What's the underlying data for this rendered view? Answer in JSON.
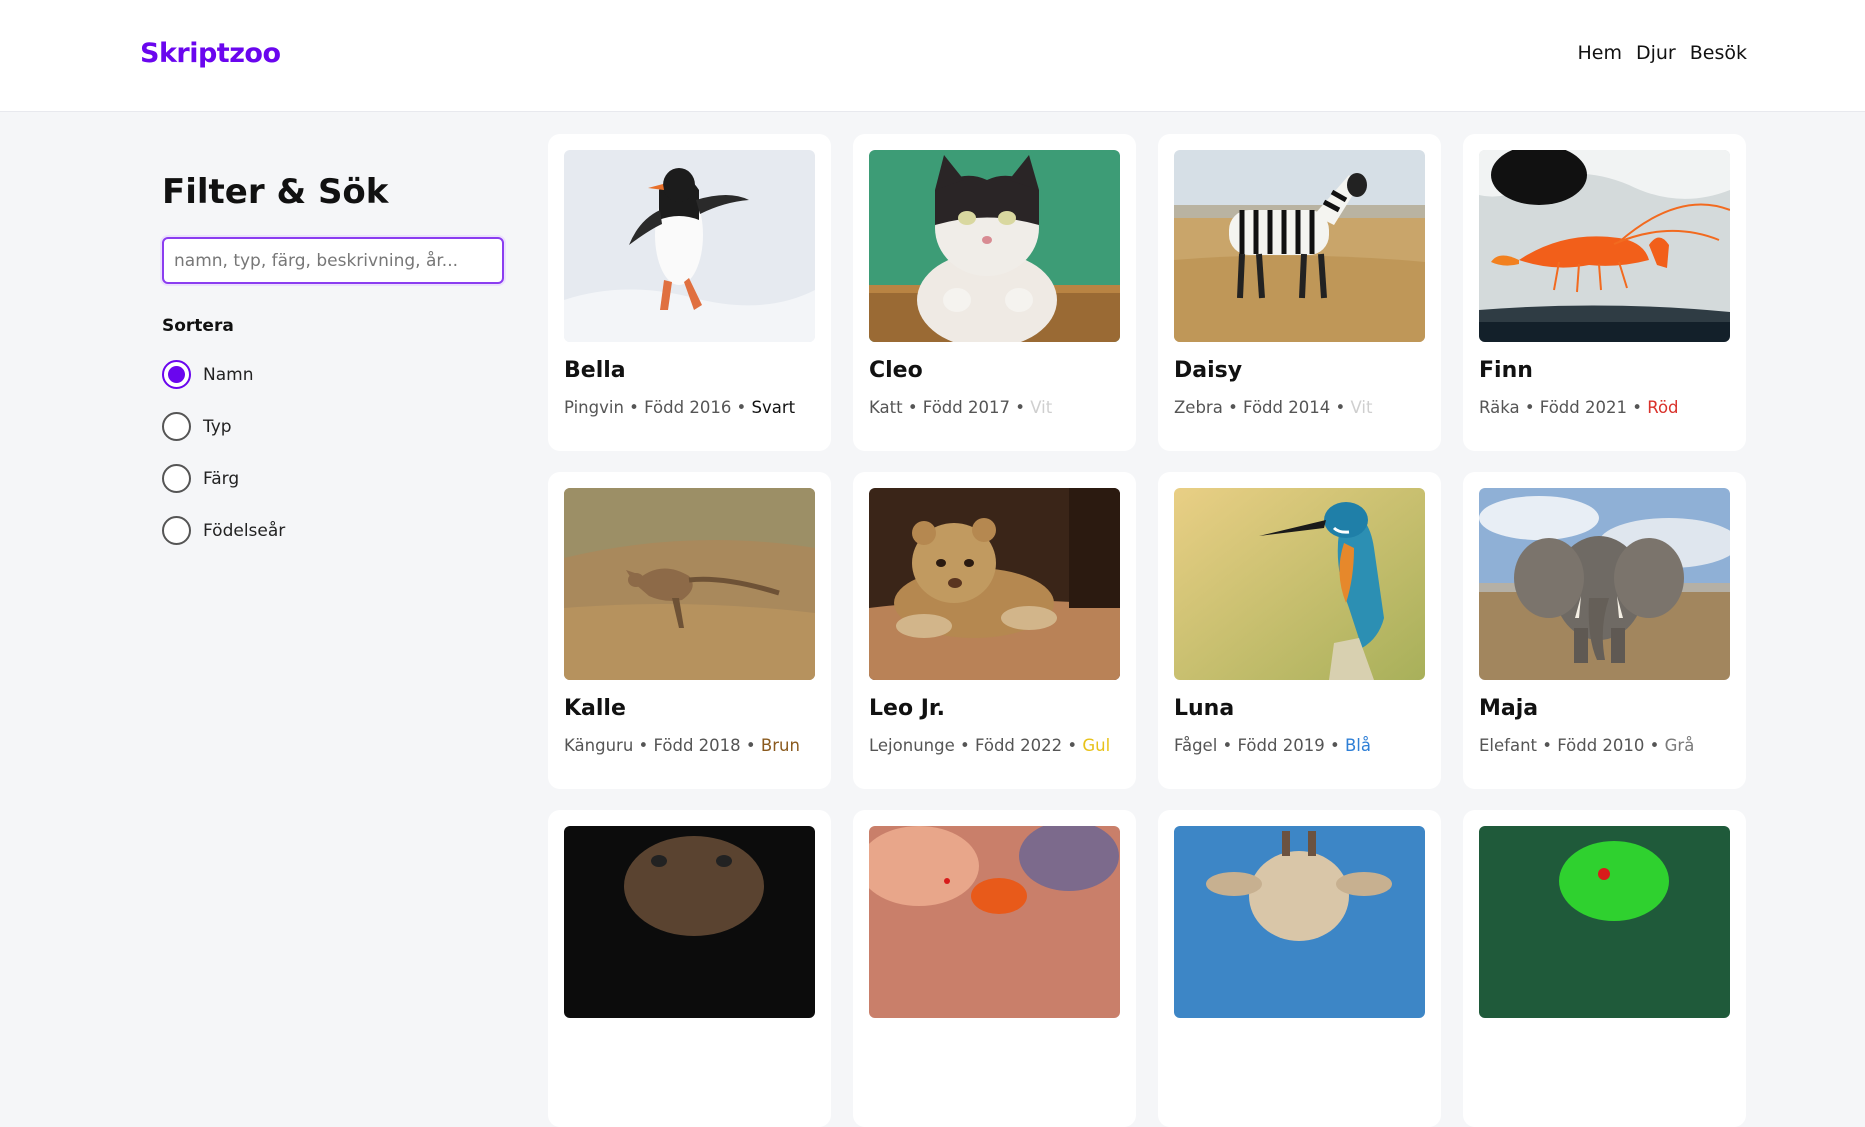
{
  "header": {
    "logo": "Skriptzoo",
    "nav": [
      "Hem",
      "Djur",
      "Besök"
    ]
  },
  "sidebar": {
    "title": "Filter & Sök",
    "search_placeholder": "namn, typ, färg, beskrivning, år...",
    "sort_label": "Sortera",
    "sort_options": [
      {
        "label": "Namn",
        "checked": true
      },
      {
        "label": "Typ",
        "checked": false
      },
      {
        "label": "Färg",
        "checked": false
      },
      {
        "label": "Födelseår",
        "checked": false
      }
    ]
  },
  "animals": [
    {
      "name": "Bella",
      "info": "Pingvin • Född 2016 •",
      "color": "Svart",
      "color_hex": "#111111",
      "image": "penguin-photo"
    },
    {
      "name": "Cleo",
      "info": "Katt • Född 2017 •",
      "color": "Vit",
      "color_hex": "#cfcfcf",
      "image": "cat-photo"
    },
    {
      "name": "Daisy",
      "info": "Zebra • Född 2014 •",
      "color": "Vit",
      "color_hex": "#cfcfcf",
      "image": "zebra-photo"
    },
    {
      "name": "Finn",
      "info": "Räka • Född 2021 •",
      "color": "Röd",
      "color_hex": "#d9322b",
      "image": "shrimp-photo"
    },
    {
      "name": "Kalle",
      "info": "Känguru • Född 2018 •",
      "color": "Brun",
      "color_hex": "#8a5a1e",
      "image": "kangaroo-photo"
    },
    {
      "name": "Leo Jr.",
      "info": "Lejonunge • Född 2022 •",
      "color": "Gul",
      "color_hex": "#e8c21a",
      "image": "lion-cub-photo"
    },
    {
      "name": "Luna",
      "info": "Fågel • Född 2019 •",
      "color": "Blå",
      "color_hex": "#2f7fd6",
      "image": "kingfisher-photo"
    },
    {
      "name": "Maja",
      "info": "Elefant • Född 2010 •",
      "color": "Grå",
      "color_hex": "#7a7a7a",
      "image": "elephant-photo"
    },
    {
      "name": "",
      "info": "",
      "color": "",
      "color_hex": "#111111",
      "image": "bear-photo"
    },
    {
      "name": "",
      "info": "",
      "color": "",
      "color_hex": "#111111",
      "image": "fish-photo"
    },
    {
      "name": "",
      "info": "",
      "color": "",
      "color_hex": "#111111",
      "image": "giraffe-photo"
    },
    {
      "name": "",
      "info": "",
      "color": "",
      "color_hex": "#111111",
      "image": "parrot-photo"
    }
  ]
}
